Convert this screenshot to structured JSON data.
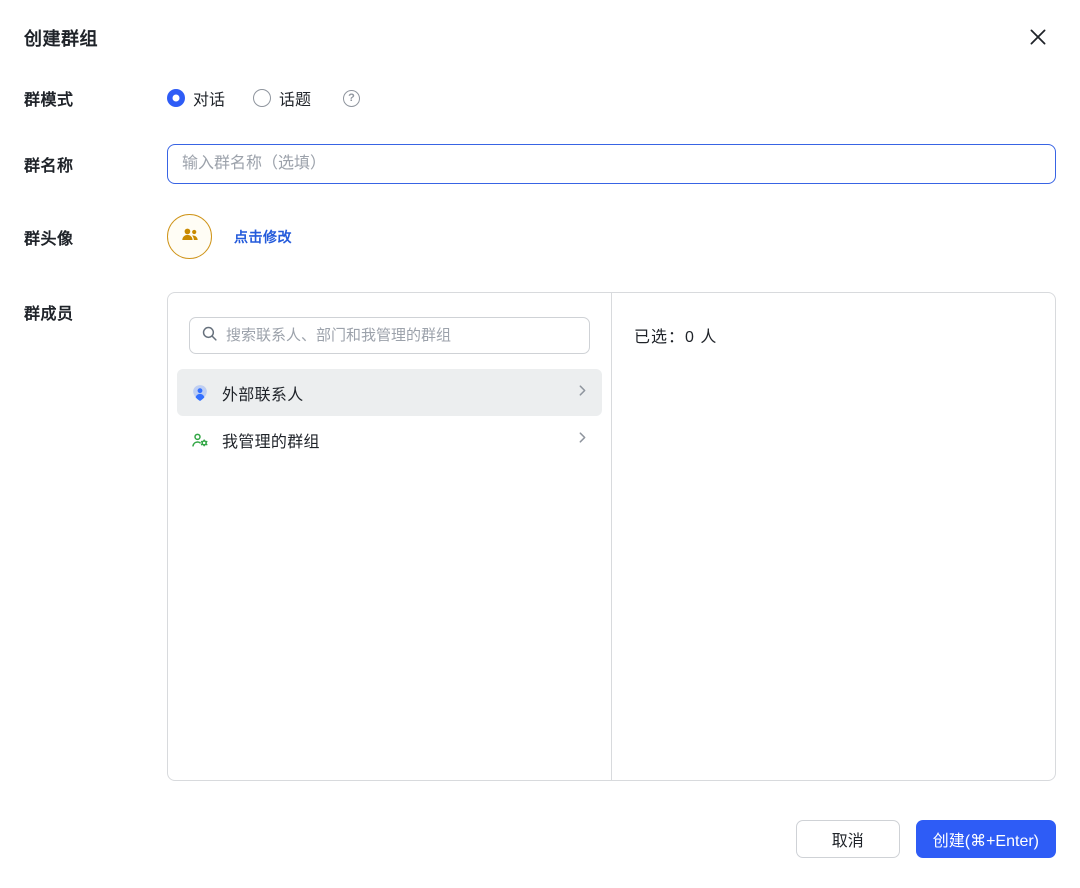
{
  "dialog": {
    "title": "创建群组"
  },
  "form": {
    "mode": {
      "label": "群模式",
      "options": [
        {
          "label": "对话",
          "selected": true
        },
        {
          "label": "话题",
          "selected": false
        }
      ]
    },
    "name": {
      "label": "群名称",
      "value": "",
      "placeholder": "输入群名称（选填）"
    },
    "avatar": {
      "label": "群头像",
      "edit_link": "点击修改"
    },
    "members": {
      "label": "群成员",
      "search_placeholder": "搜索联系人、部门和我管理的群组",
      "items": [
        {
          "label": "外部联系人",
          "icon": "external-contacts-icon",
          "selected": true
        },
        {
          "label": "我管理的群组",
          "icon": "managed-groups-icon",
          "selected": false
        }
      ],
      "selected_summary": "已选：0 人"
    }
  },
  "footer": {
    "cancel_label": "取消",
    "create_label": "创建(⌘+Enter)"
  },
  "colors": {
    "primary": "#2e5cf6",
    "link": "#245bdb",
    "avatar_orange": "#c98a00",
    "icon_blue": "#3370ff",
    "icon_green": "#32a645",
    "selected_item_bg": "#eceeef"
  }
}
